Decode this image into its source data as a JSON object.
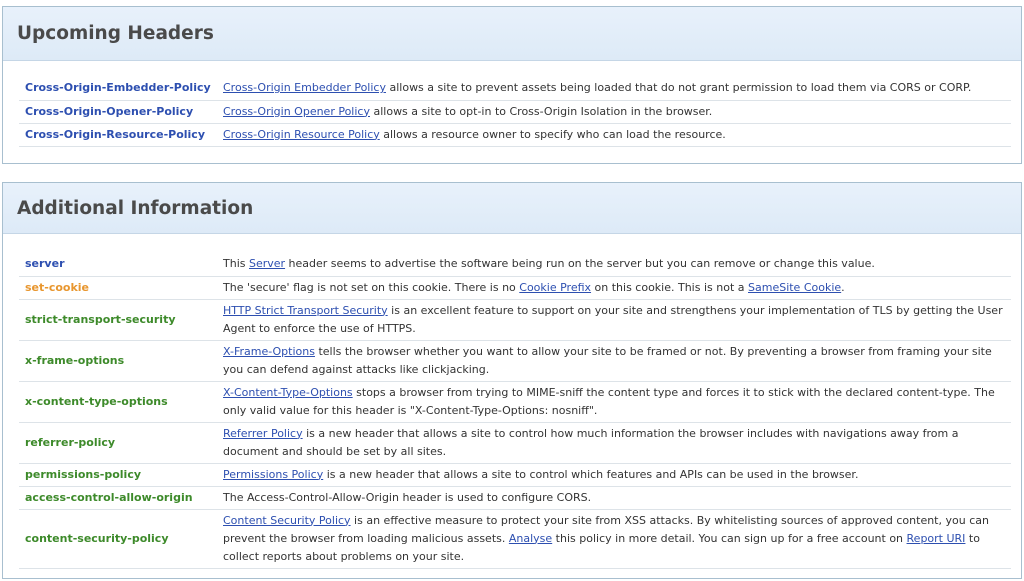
{
  "upcoming": {
    "title": "Upcoming Headers",
    "rows": [
      {
        "name": "Cross-Origin-Embedder-Policy",
        "link": "Cross-Origin Embedder Policy",
        "text": " allows a site to prevent assets being loaded that do not grant permission to load them via CORS or CORP."
      },
      {
        "name": "Cross-Origin-Opener-Policy",
        "link": "Cross-Origin Opener Policy",
        "text": " allows a site to opt-in to Cross-Origin Isolation in the browser."
      },
      {
        "name": "Cross-Origin-Resource-Policy",
        "link": "Cross-Origin Resource Policy",
        "text": " allows a resource owner to specify who can load the resource."
      }
    ]
  },
  "additional": {
    "title": "Additional Information",
    "server": {
      "name": "server",
      "t1": "This ",
      "link": "Server",
      "t2": " header seems to advertise the software being run on the server but you can remove or change this value."
    },
    "set_cookie": {
      "name": "set-cookie",
      "t1": "The 'secure' flag is not set on this cookie. There is no ",
      "link1": "Cookie Prefix",
      "t2": " on this cookie. This is not a ",
      "link2": "SameSite Cookie",
      "t3": "."
    },
    "hsts": {
      "name": "strict-transport-security",
      "link": "HTTP Strict Transport Security",
      "t1": " is an excellent feature to support on your site and strengthens your implementation of TLS by getting the User Agent to enforce the use of HTTPS."
    },
    "xfo": {
      "name": "x-frame-options",
      "link": "X-Frame-Options",
      "t1": " tells the browser whether you want to allow your site to be framed or not. By preventing a browser from framing your site you can defend against attacks like clickjacking."
    },
    "xcto": {
      "name": "x-content-type-options",
      "link": "X-Content-Type-Options",
      "t1": " stops a browser from trying to MIME-sniff the content type and forces it to stick with the declared content-type. The only valid value for this header is \"X-Content-Type-Options: nosniff\"."
    },
    "referrer": {
      "name": "referrer-policy",
      "link": "Referrer Policy",
      "t1": " is a new header that allows a site to control how much information the browser includes with navigations away from a document and should be set by all sites."
    },
    "permissions": {
      "name": "permissions-policy",
      "link": "Permissions Policy",
      "t1": " is a new header that allows a site to control which features and APIs can be used in the browser."
    },
    "acao": {
      "name": "access-control-allow-origin",
      "t1": "The Access-Control-Allow-Origin header is used to configure CORS."
    },
    "csp": {
      "name": "content-security-policy",
      "link1": "Content Security Policy",
      "t1": " is an effective measure to protect your site from XSS attacks. By whitelisting sources of approved content, you can prevent the browser from loading malicious assets. ",
      "link2": "Analyse",
      "t2": " this policy in more detail. You can sign up for a free account on ",
      "link3": "Report URI",
      "t3": " to collect reports about problems on your site."
    }
  },
  "colors": {
    "blue": "#2d4fb0",
    "orange": "#e8962e",
    "green": "#3d8a2a"
  }
}
